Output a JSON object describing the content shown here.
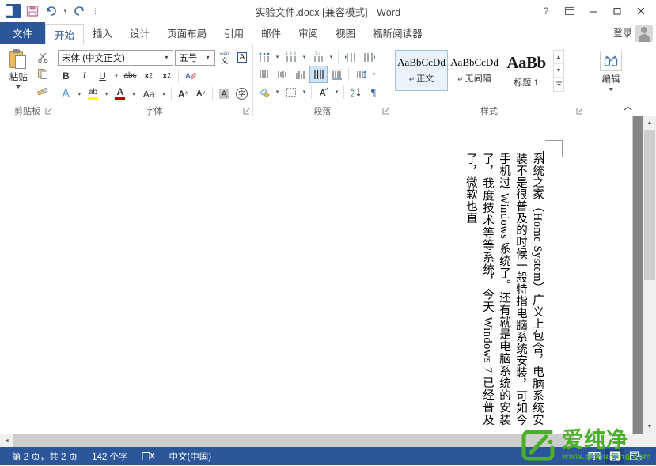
{
  "window": {
    "title": "实验文件.docx [兼容模式] - Word",
    "help_icon": "?",
    "ribbon_options_icon": "ribbon-display-options-icon",
    "minimize_icon": "−",
    "maximize_icon": "□",
    "close_icon": "✕"
  },
  "qat": {
    "app_icon": "word-icon",
    "app_letter": "W",
    "save_icon": "save-icon",
    "undo_icon": "↶",
    "undo_caret": "▾",
    "redo_icon": "↷",
    "customize_icon": "⋮"
  },
  "tabs": [
    {
      "label": "文件",
      "type": "file"
    },
    {
      "label": "开始",
      "type": "active"
    },
    {
      "label": "插入",
      "type": "normal"
    },
    {
      "label": "设计",
      "type": "normal"
    },
    {
      "label": "页面布局",
      "type": "normal"
    },
    {
      "label": "引用",
      "type": "normal"
    },
    {
      "label": "邮件",
      "type": "normal"
    },
    {
      "label": "审阅",
      "type": "normal"
    },
    {
      "label": "视图",
      "type": "normal"
    },
    {
      "label": "福昕阅读器",
      "type": "normal"
    }
  ],
  "account": {
    "signin_label": "登录",
    "avatar": "user-avatar"
  },
  "ribbon": {
    "collapse_icon": "⌃",
    "clipboard": {
      "group_label": "剪贴板",
      "paste_label": "粘贴",
      "paste_caret": "▾",
      "cut_icon": "✂",
      "copy_icon": "copy-icon",
      "format_painter_icon": "format-painter-icon",
      "dialog_launcher": "⌐"
    },
    "font": {
      "group_label": "字体",
      "font_name": "宋体 (中文正文)",
      "font_size": "五号",
      "combo_caret": "▾",
      "phonetic_guide_icon": "wén",
      "char_border_icon": "A",
      "bold": "B",
      "italic": "I",
      "underline": "U",
      "strikethrough": "abc",
      "subscript": "x₂",
      "superscript": "x²",
      "clear_format_icon": "clear-formatting-icon",
      "text_effects": "A",
      "highlight": "ab",
      "font_color": "A",
      "change_case": "Aa",
      "grow_font": "A˄",
      "shrink_font": "A˅",
      "char_shading": "A",
      "enclose_char": "字",
      "dialog_launcher": "⌐",
      "font_color_hex": "#c00000",
      "highlight_hex": "#ffff00"
    },
    "paragraph": {
      "group_label": "段落",
      "bullets_icon": "bullets-icon",
      "numbering_icon": "numbering-icon",
      "multilevel_icon": "multilevel-list-icon",
      "decrease_indent_icon": "decrease-indent-icon",
      "increase_indent_icon": "increase-indent-icon",
      "align_top_icon": "align-top-icon",
      "align_center_icon": "align-center-icon",
      "align_bottom_icon": "align-bottom-icon",
      "justify_icon": "justify-icon",
      "distributed_icon": "distributed-icon",
      "line_spacing_icon": "line-spacing-icon",
      "shading_icon": "shading-icon",
      "borders_icon": "borders-icon",
      "asian_layout_icon": "asian-layout-icon",
      "sort_icon": "sort-icon",
      "show_marks_icon": "show-formatting-marks-icon",
      "caret": "▾",
      "dialog_launcher": "⌐"
    },
    "styles": {
      "group_label": "样式",
      "items": [
        {
          "sample": "AaBbCcDd",
          "name": "正文",
          "pilcrow": "↵",
          "selected": true,
          "heading": false
        },
        {
          "sample": "AaBbCcDd",
          "name": "无间隔",
          "pilcrow": "↵",
          "selected": false,
          "heading": false
        },
        {
          "sample": "AaBb",
          "name": "标题 1",
          "pilcrow": "",
          "selected": false,
          "heading": true
        }
      ],
      "scroll_up": "▲",
      "scroll_down": "▼",
      "more": "▾",
      "dialog_launcher": "⌐"
    },
    "editing": {
      "group_label": "编辑",
      "icon": "find-binoculars-icon",
      "caret": "▾"
    }
  },
  "document": {
    "text": "系统之家（Home System）广义上包含，电脑系统安装不是很普及的时候一般特指电脑系统安装，可如今手机过 Windows 系统了。还有就是电脑系统的安装了，我度技术等等系统，今天 Windows 7 已经普及了，微软也直",
    "margin_corner": "margin-corner-mark"
  },
  "scrollbars": {
    "v_up": "▲",
    "v_down": "▼",
    "h_left": "◄",
    "h_right": "►"
  },
  "statusbar": {
    "page_info": "第 2 页，共 2 页",
    "word_count": "142 个字",
    "proofing_icon": "proofing-errors-icon",
    "language": "中文(中国)",
    "view_read_icon": "read-mode-icon",
    "view_print_icon": "print-layout-icon",
    "view_web_icon": "web-layout-icon"
  },
  "watermark": {
    "brand": "爱纯净",
    "url": "www.aichunjing.com",
    "logo_hex": "#4caf28"
  }
}
